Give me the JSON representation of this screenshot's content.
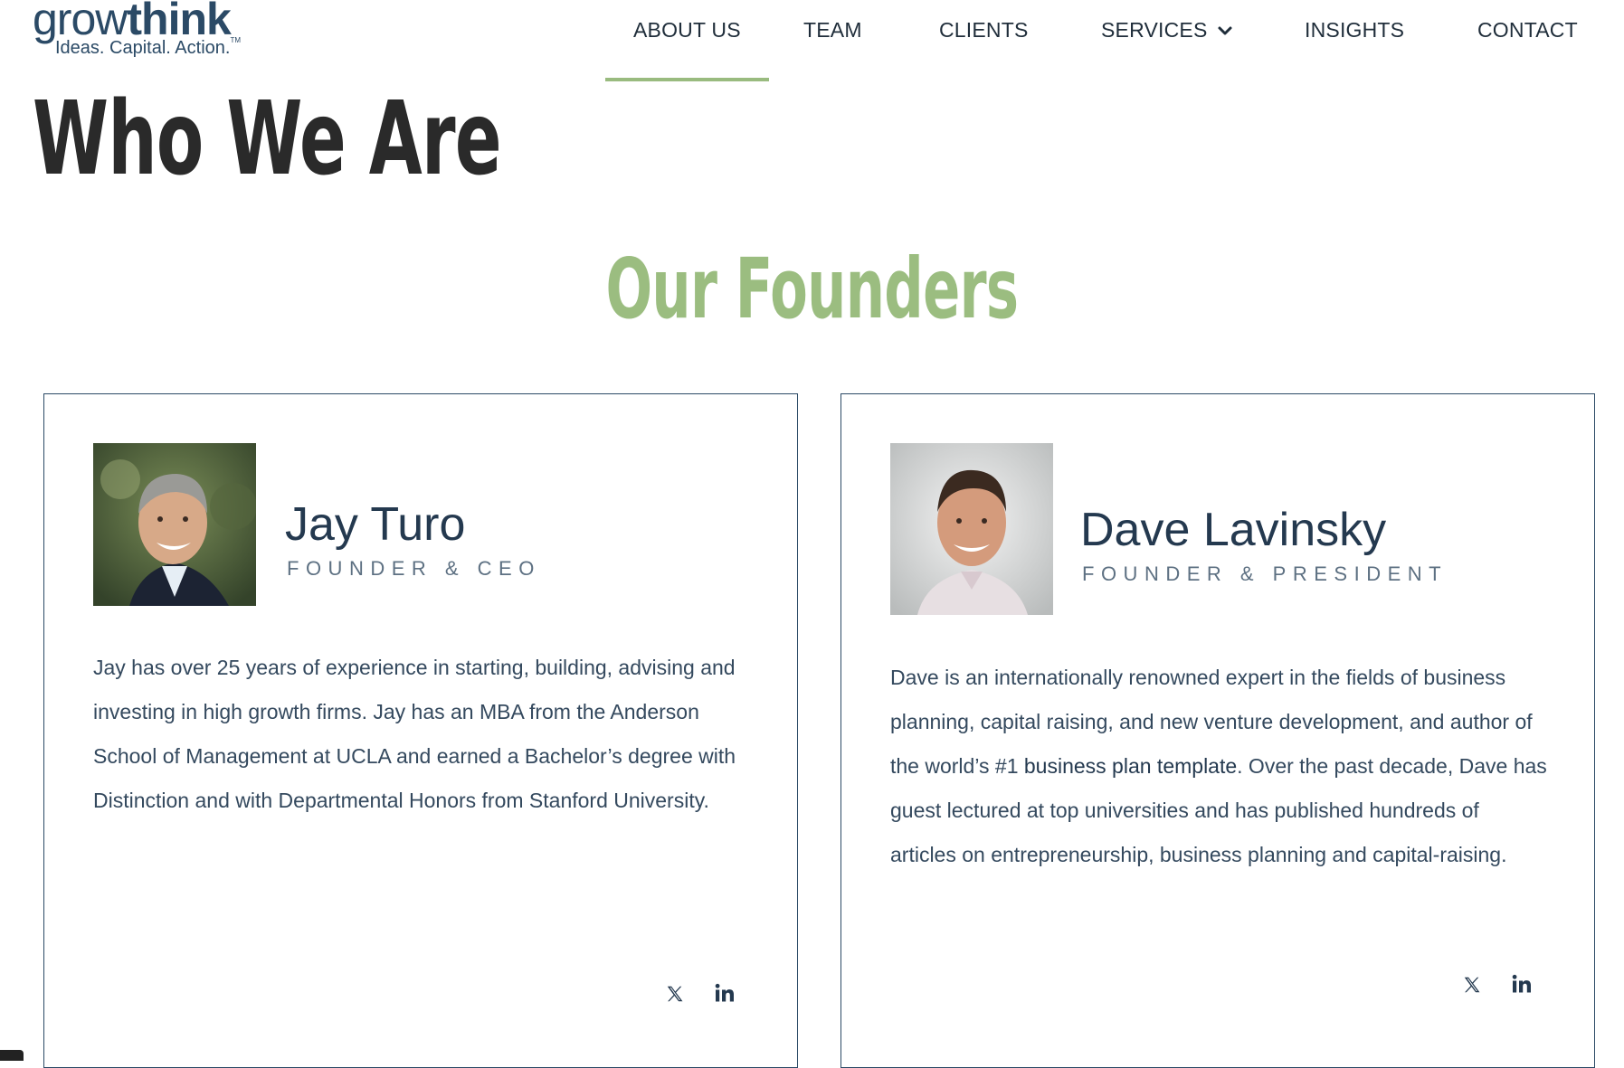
{
  "logo": {
    "word_light": "grow",
    "word_bold": "think",
    "tagline": "Ideas. Capital. Action.",
    "trademark": "TM"
  },
  "nav": {
    "items": [
      {
        "label": "ABOUT US",
        "active": true
      },
      {
        "label": "TEAM"
      },
      {
        "label": "CLIENTS"
      },
      {
        "label": "SERVICES",
        "has_dropdown": true
      },
      {
        "label": "INSIGHTS"
      },
      {
        "label": "CONTACT"
      }
    ]
  },
  "page": {
    "title": "Who We Are",
    "section_title": "Our Founders"
  },
  "founders": [
    {
      "name": "Jay Turo",
      "role": "FOUNDER & CEO",
      "bio": "Jay has over 25 years of experience in starting, building, advising and investing in high growth firms. Jay has an MBA from the Anderson School of Management at UCLA and earned a Bachelor’s degree with Distinction and with Departmental Honors from Stanford University.",
      "social": [
        "x-icon",
        "linkedin-icon"
      ]
    },
    {
      "name": "Dave Lavinsky",
      "role": "FOUNDER & PRESIDENT",
      "bio_before_link": "Dave is an internationally renowned expert in the fields of business planning, capital raising, and new venture development, and author of the world’s #1 ",
      "bio_link": "business plan template",
      "bio_after_link": ".  Over the past decade, Dave has guest lectured at top universities and has published hundreds of articles on entrepreneurship, business planning and capital-raising.",
      "social": [
        "x-icon",
        "linkedin-icon"
      ]
    }
  ],
  "icons": {
    "social_x": "x-icon",
    "social_linkedin": "linkedin-icon",
    "dropdown": "chevron-down-icon"
  },
  "colors": {
    "brand_navy": "#2b4a66",
    "accent_green": "#9bbd80",
    "title_dark": "#2a2a2a"
  }
}
